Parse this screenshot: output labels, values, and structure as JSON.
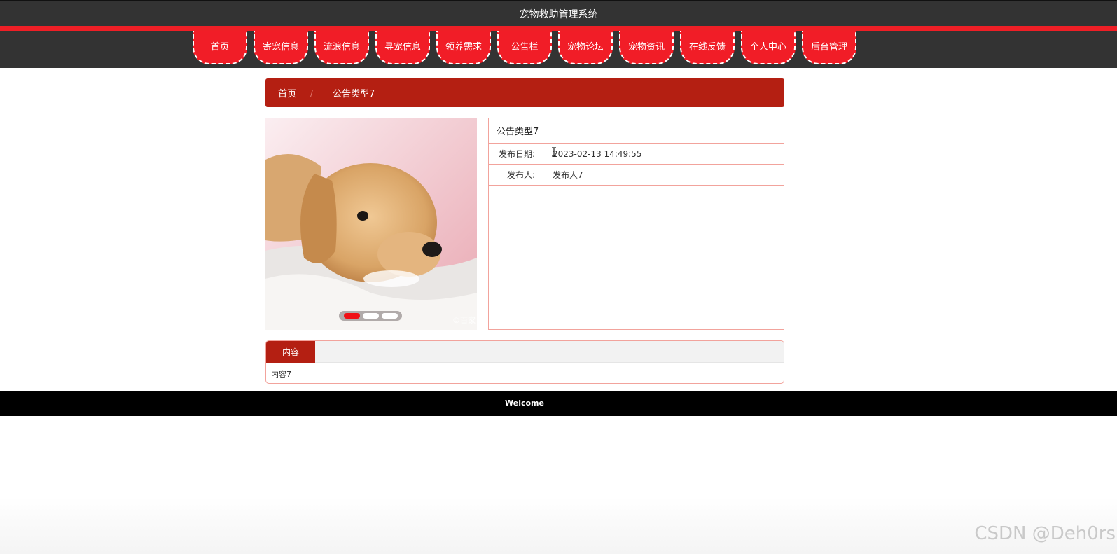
{
  "header": {
    "site_title": "宠物救助管理系统"
  },
  "nav": {
    "items": [
      "首页",
      "寄宠信息",
      "流浪信息",
      "寻宠信息",
      "领养需求",
      "公告栏",
      "宠物论坛",
      "宠物资讯",
      "在线反馈",
      "个人中心",
      "后台管理"
    ]
  },
  "breadcrumb": {
    "home": "首页",
    "separator": "/",
    "current": "公告类型7"
  },
  "carousel": {
    "watermark": "©百家",
    "slides": 3,
    "active_slide": 1
  },
  "info": {
    "title": "公告类型7",
    "rows": [
      {
        "label": "发布日期:",
        "value": "2023-02-13 14:49:55"
      },
      {
        "label": "发布人:",
        "value": "发布人7"
      }
    ]
  },
  "content": {
    "tab_label": "内容",
    "body": "内容7"
  },
  "footer": {
    "text": "Welcome"
  },
  "page_watermark": "CSDN @Deh0rs",
  "colors": {
    "nav_red": "#f11d27",
    "breadcrumb_red": "#b41f12",
    "dark_bar": "#333333",
    "border_pink": "#f2a39c"
  }
}
